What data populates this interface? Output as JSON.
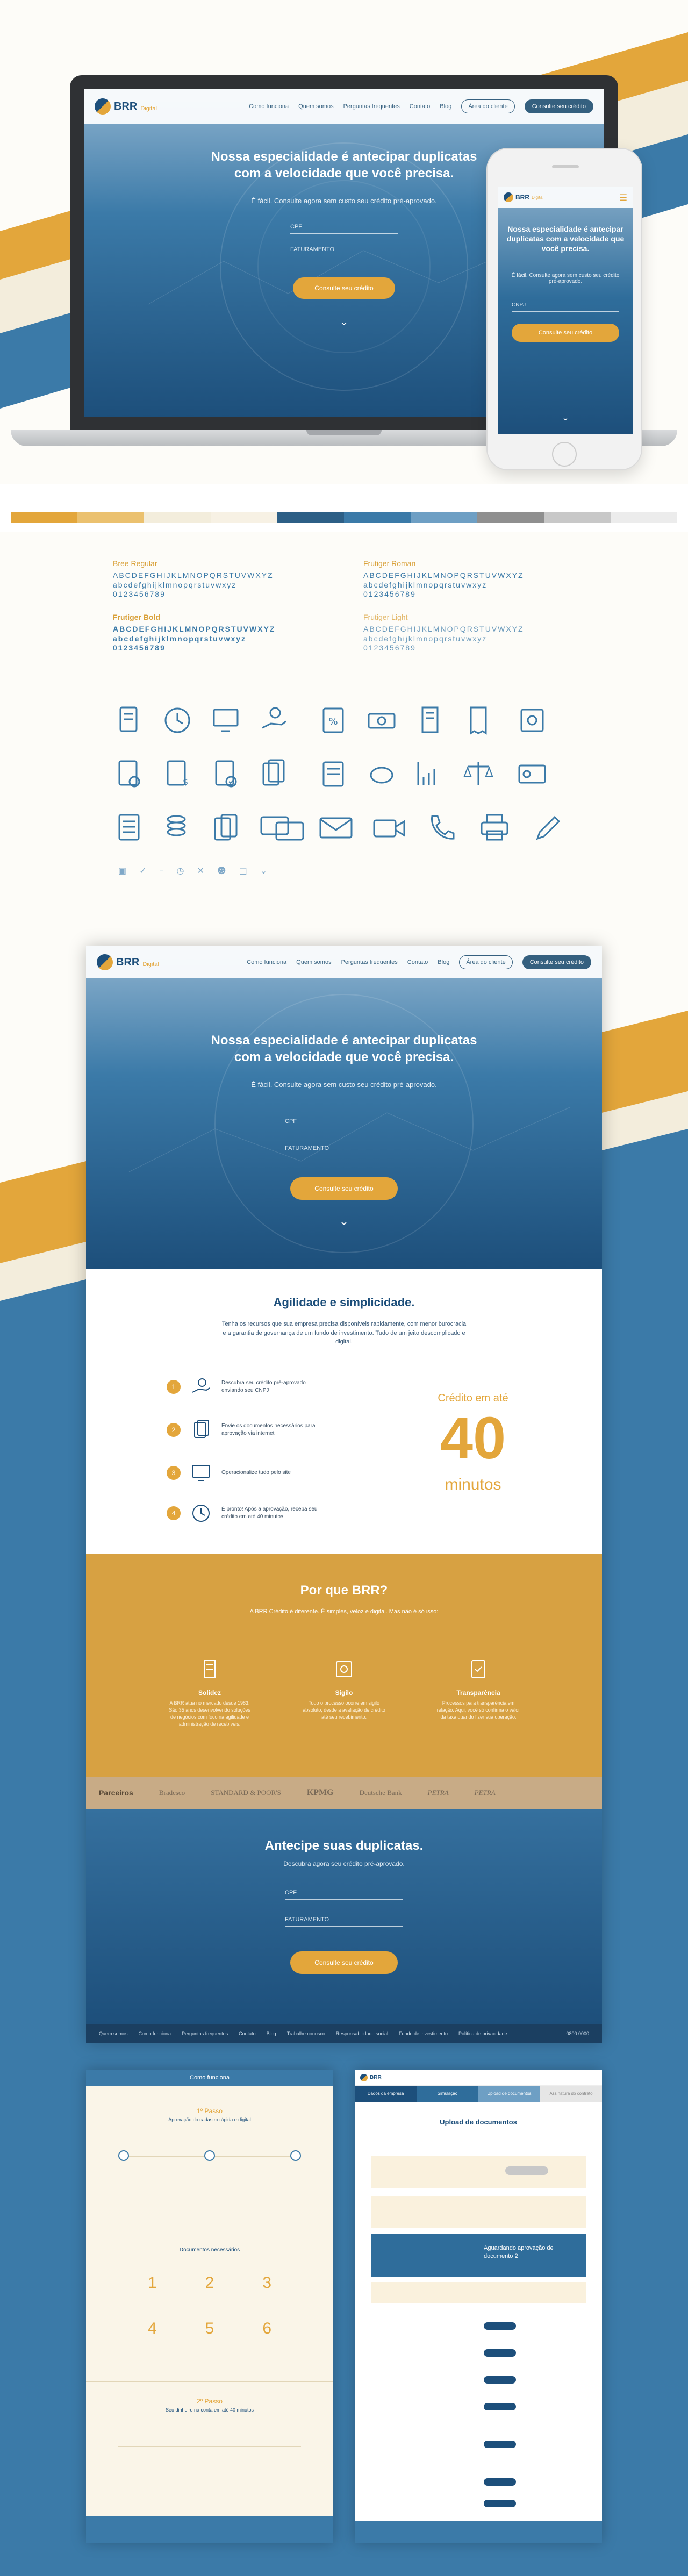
{
  "brand": {
    "name": "BRR",
    "sub": "Digital",
    "gold": "#e3a63b",
    "blue": "#3b7aa8",
    "navy": "#1d4f7b"
  },
  "nav": {
    "links": [
      "Como funciona",
      "Quem somos",
      "Perguntas frequentes",
      "Contato",
      "Blog"
    ],
    "client_area": "Área do cliente",
    "cta": "Consulte seu crédito"
  },
  "hero": {
    "title_line1": "Nossa especialidade é antecipar duplicatas",
    "title_line2": "com a velocidade que você precisa.",
    "subtitle": "É fácil. Consulte agora sem custo seu crédito pré-aprovado.",
    "field_cpf": "CPF",
    "field_faturamento": "FATURAMENTO",
    "button": "Consulte seu crédito"
  },
  "phone": {
    "title": "Nossa especialidade é antecipar duplicatas com a velocidade que você precisa.",
    "subtitle": "É fácil. Consulte agora sem custo seu crédito pré-aprovado.",
    "field": "CNPJ",
    "button": "Consulte seu crédito"
  },
  "palette": [
    "#e3a63b",
    "#ebc16f",
    "#f3eddc",
    "#f7f1e4",
    "#2d5f86",
    "#3b7aa8",
    "#6e9fc4",
    "#8f8f8f",
    "#c8c8c8",
    "#ececec"
  ],
  "typography": {
    "bree_regular": {
      "name": "Bree Regular",
      "upper": "ABCDEFGHIJKLMNOPQRSTUVWXYZ",
      "lower": "abcdefghijklmnopqrstuvwxyz",
      "digits": "0123456789"
    },
    "bree_bold": {
      "name": "Frutiger Bold",
      "upper": "ABCDEFGHIJKLMNOPQRSTUVWXYZ",
      "lower": "abcdefghijklmnopqrstuvwxyz",
      "digits": "0123456789"
    },
    "frutiger_roman": {
      "name": "Frutiger Roman",
      "upper": "ABCDEFGHIJKLMNOPQRSTUVWXYZ",
      "lower": "abcdefghijklmnopqrstuvwxyz",
      "digits": "0123456789"
    },
    "frutiger_light": {
      "name": "Frutiger Light",
      "upper": "ABCDEFGHIJKLMNOPQRSTUVWXYZ",
      "lower": "abcdefghijklmnopqrstuvwxyz",
      "digits": "0123456789"
    }
  },
  "icons": [
    "document-icon",
    "clock-icon",
    "computer-icon",
    "money-hand-icon",
    "percent-icon",
    "money-icon",
    "building-icon",
    "receipt-icon",
    "safe-icon",
    "user-document-icon",
    "money-document-icon",
    "check-document-icon",
    "documents-icon",
    "invoice-icon",
    "piggy-bank-icon",
    "chart-icon",
    "scale-icon",
    "id-card-icon",
    "list-document-icon",
    "coins-icon",
    "document-copy-icon",
    "chat-icon",
    "envelope-icon",
    "video-icon",
    "phone-icon",
    "printer-icon",
    "pencil-icon"
  ],
  "agility": {
    "title": "Agilidade e simplicidade.",
    "text": "Tenha os recursos que sua empresa precisa disponíveis rapidamente, com menor burocracia e a garantia de governança de um fundo de investimento. Tudo de um jeito descomplicado e digital.",
    "steps": [
      {
        "num": "1",
        "text": "Descubra seu crédito pré-aprovado enviando seu CNPJ"
      },
      {
        "num": "2",
        "text": "Envie os documentos necessários para aprovação via internet"
      },
      {
        "num": "3",
        "text": "Operacionalize tudo pelo site"
      },
      {
        "num": "4",
        "text": "É pronto! Após a aprovação, receba seu crédito em até 40 minutos"
      }
    ],
    "credit_label": "Crédito em até",
    "credit_number": "40",
    "credit_unit": "minutos"
  },
  "why": {
    "title": "Por que BRR?",
    "text": "A BRR Crédito é diferente. É simples, veloz e digital. Mas não é só isso:",
    "cols": [
      {
        "title": "Solidez",
        "text": "A BRR atua no mercado desde 1983. São 35 anos desenvolvendo soluções de negócios com foco na agilidade e administração de recebíveis."
      },
      {
        "title": "Sigilo",
        "text": "Todo o processo ocorre em sigilo absoluto, desde a avaliação de crédito até seu recebimento."
      },
      {
        "title": "Transparência",
        "text": "Processos para transparência em relação. Aqui, você só confirma o valor da taxa quando fizer sua operação."
      }
    ]
  },
  "partners": {
    "label": "Parceiros",
    "names": [
      "Bradesco",
      "STANDARD & POOR'S",
      "KPMG",
      "Deutsche Bank",
      "PETRA",
      "PETRA"
    ]
  },
  "cta": {
    "title": "Antecipe suas duplicatas.",
    "subtitle": "Descubra agora seu crédito pré-aprovado.",
    "field_cpf": "CPF",
    "field_faturamento": "FATURAMENTO",
    "button": "Consulte seu crédito"
  },
  "footer": {
    "links": [
      "Quem somos",
      "Como funciona",
      "Perguntas frequentes",
      "Contato",
      "Blog",
      "Trabalhe conosco",
      "Responsabilidade social",
      "Fundo de investimento",
      "Política de privacidade"
    ],
    "phone": "0800 0000"
  },
  "screen_a": {
    "header": "Como funciona",
    "step1_label": "1º Passo",
    "step1_title": "Aprovação do cadastro rápida e digital",
    "docs_title": "Documentos necessários",
    "step2_label": "2º Passo",
    "step2_title": "Seu dinheiro na conta em até 40 minutos"
  },
  "screen_b": {
    "tabs": [
      "Dados da empresa",
      "Simulação",
      "Upload de documentos",
      "Assinatura do contrato"
    ],
    "title": "Upload de documentos",
    "status": "Aguardando aprovação de documento 2"
  }
}
